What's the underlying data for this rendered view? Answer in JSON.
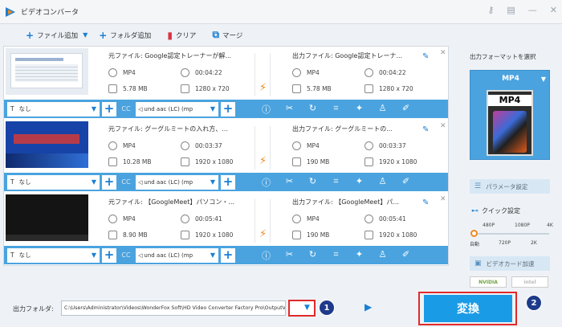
{
  "window": {
    "title": "ビデオコンバータ",
    "icons": [
      "key-icon",
      "settings-icon",
      "minimize-icon",
      "close-icon"
    ]
  },
  "toolbar": {
    "add_file": "ファイル追加",
    "add_folder": "フォルダ追加",
    "clear": "クリア",
    "merge": "マージ"
  },
  "items": [
    {
      "src_name": "元ファイル: Google認定トレーナーが解...",
      "src_format": "MP4",
      "src_duration": "00:04:22",
      "src_size": "5.78 MB",
      "src_res": "1280 x 720",
      "out_name": "出力ファイル: Google認定トレーナ...",
      "out_format": "MP4",
      "out_duration": "00:04:22",
      "out_size": "5.78 MB",
      "out_res": "1280 x 720",
      "subtitle": "なし",
      "audio": "und aac (LC) (mp"
    },
    {
      "src_name": "元ファイル: グーグルミートの入れ方、...",
      "src_format": "MP4",
      "src_duration": "00:03:37",
      "src_size": "10.28 MB",
      "src_res": "1920 x 1080",
      "out_name": "出力ファイル: グーグルミートの...",
      "out_format": "MP4",
      "out_duration": "00:03:37",
      "out_size": "190 MB",
      "out_res": "1920 x 1080",
      "subtitle": "なし",
      "audio": "und aac (LC) (mp"
    },
    {
      "src_name": "元ファイル: 【GoogleMeet】パソコン・...",
      "src_format": "MP4",
      "src_duration": "00:05:41",
      "src_size": "8.90 MB",
      "src_res": "1920 x 1080",
      "out_name": "出力ファイル: 【GoogleMeet】パ...",
      "out_format": "MP4",
      "out_duration": "00:05:41",
      "out_size": "190 MB",
      "out_res": "1920 x 1080",
      "subtitle": "なし",
      "audio": "und aac (LC) (mp"
    }
  ],
  "right_panel": {
    "format_label": "出力フォーマットを選択",
    "format": "MP4",
    "format_badge": "MP4",
    "param_settings": "パラメータ設定",
    "quick_settings": "クイック設定",
    "q_top": [
      "480P",
      "1080P",
      "4K"
    ],
    "q_bottom": [
      "自動",
      "720P",
      "2K"
    ],
    "gpu_accel": "ビデオカード加速",
    "vendors": [
      "NVIDIA",
      "intel"
    ]
  },
  "bottom": {
    "output_label": "出力フォルダ:",
    "output_path": "C:\\Users\\Administrator\\Videos\\WonderFox Soft\\HD Video Converter Factory Pro\\OutputVideo\\",
    "convert": "変換",
    "badge1": "1",
    "badge2": "2"
  },
  "colors": {
    "accent": "#4aa3df",
    "convert": "#1a9be6",
    "highlight": "#e02a2a",
    "bolt": "#f08a1c"
  }
}
